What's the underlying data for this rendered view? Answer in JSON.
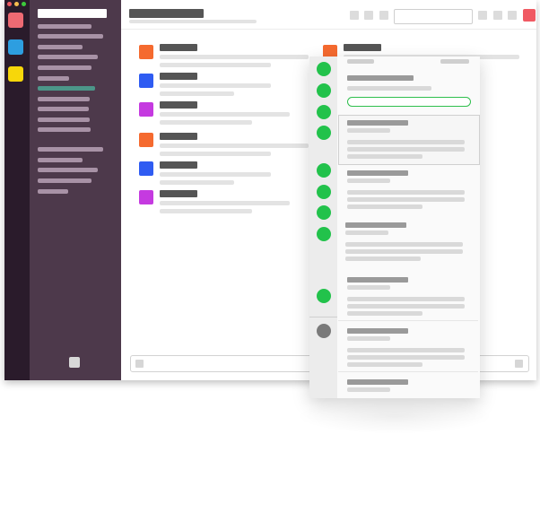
{
  "window": {
    "traffic_lights": [
      "#f05a63",
      "#f5bd4f",
      "#3cc83b"
    ]
  },
  "workspaces": [
    {
      "name": "workspace-red",
      "color": "#ee6a73"
    },
    {
      "name": "workspace-blue",
      "color": "#2d9ee0"
    },
    {
      "name": "workspace-yellow",
      "color": "#f7d70a"
    }
  ],
  "sidebar": {
    "active_color": "#4c9689"
  },
  "messages": {
    "avatar_colors": [
      "#f56a2f",
      "#2f5cf2",
      "#c53ae0",
      "#f56a2f",
      "#2f5cf2",
      "#c53ae0",
      "#f56a2f"
    ]
  },
  "panel": {
    "status_online_color": "#22c24b",
    "status_away_color": "#7a7a7a"
  }
}
